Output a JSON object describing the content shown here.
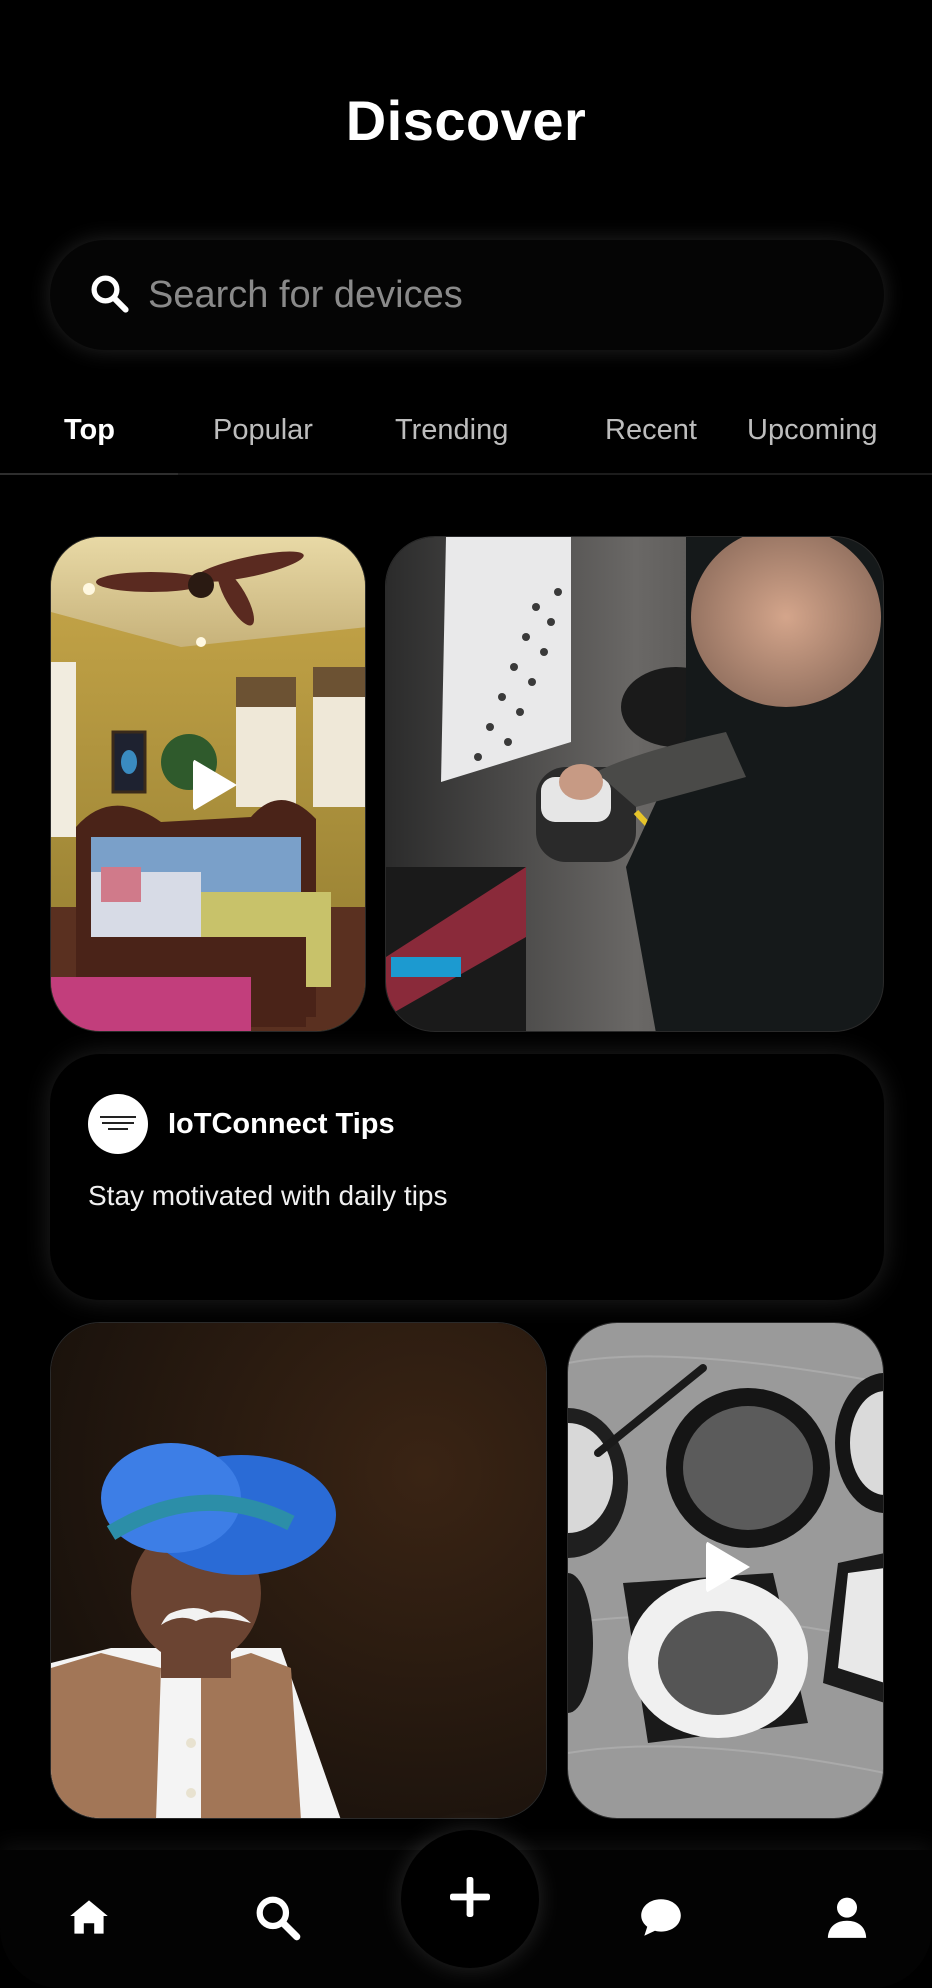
{
  "header": {
    "title": "Discover"
  },
  "search": {
    "placeholder": "Search for devices",
    "icon": "search-icon"
  },
  "tabs": [
    {
      "label": "Top",
      "active": true
    },
    {
      "label": "Popular",
      "active": false
    },
    {
      "label": "Trending",
      "active": false
    },
    {
      "label": "Recent",
      "active": false
    },
    {
      "label": "Upcoming",
      "active": false
    }
  ],
  "feed": {
    "media": [
      {
        "subject": "bedroom with ceiling fan",
        "type": "video"
      },
      {
        "subject": "electric car charging",
        "type": "image"
      },
      {
        "subject": "man in blue turban",
        "type": "image"
      },
      {
        "subject": "bowls of spices",
        "type": "video"
      }
    ],
    "tips_card": {
      "name": "IoTConnect Tips",
      "description": "Stay motivated with daily tips"
    }
  },
  "bottom_nav": {
    "items": [
      "home-icon",
      "search-icon",
      "plus-icon",
      "chat-icon",
      "profile-icon"
    ]
  },
  "colors": {
    "background": "#000000",
    "text": "#ffffff",
    "muted": "#8a8a8a"
  }
}
